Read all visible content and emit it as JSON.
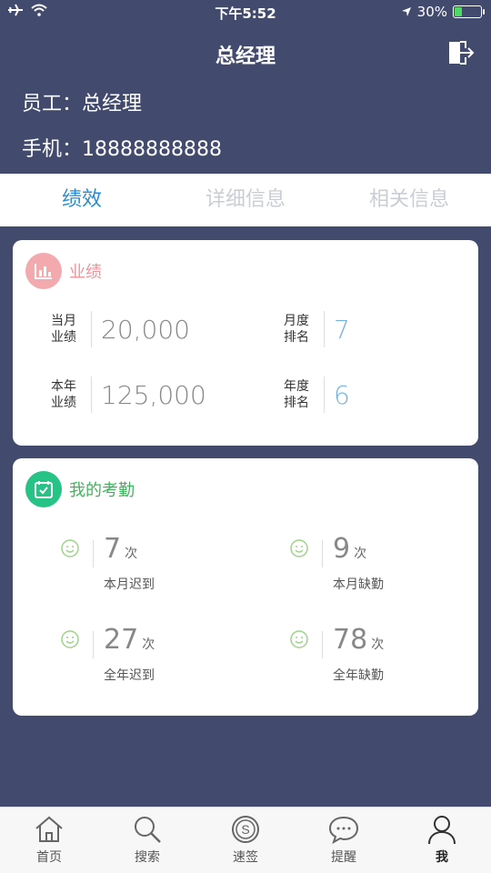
{
  "status_bar": {
    "time": "下午5:52",
    "battery_percent": "30%",
    "battery_level": 0.3
  },
  "header": {
    "title": "总经理"
  },
  "user": {
    "employee_label": "员工：",
    "employee_name": "总经理",
    "phone_label": "手机：",
    "phone": "18888888888"
  },
  "tabs": [
    {
      "label": "绩效",
      "active": true
    },
    {
      "label": "详细信息",
      "active": false
    },
    {
      "label": "相关信息",
      "active": false
    }
  ],
  "performance": {
    "title": "业绩",
    "metrics": [
      {
        "label_line1": "当月",
        "label_line2": "业绩",
        "value": "20,000"
      },
      {
        "label_line1": "月度",
        "label_line2": "排名",
        "value": "7"
      },
      {
        "label_line1": "本年",
        "label_line2": "业绩",
        "value": "125,000"
      },
      {
        "label_line1": "年度",
        "label_line2": "排名",
        "value": "6"
      }
    ]
  },
  "attendance": {
    "title": "我的考勤",
    "items": [
      {
        "value": "7",
        "unit": "次",
        "label": "本月迟到"
      },
      {
        "value": "9",
        "unit": "次",
        "label": "本月缺勤"
      },
      {
        "value": "27",
        "unit": "次",
        "label": "全年迟到"
      },
      {
        "value": "78",
        "unit": "次",
        "label": "全年缺勤"
      }
    ]
  },
  "bottom_nav": [
    {
      "label": "首页",
      "icon": "home-icon"
    },
    {
      "label": "搜索",
      "icon": "search-icon"
    },
    {
      "label": "速签",
      "icon": "quick-sign-icon"
    },
    {
      "label": "提醒",
      "icon": "chat-bubble-icon"
    },
    {
      "label": "我",
      "icon": "user-icon",
      "active": true
    }
  ],
  "colors": {
    "header_bg": "#424b6e",
    "active_tab": "#2a8bd0",
    "performance_accent": "#f3aaaf",
    "attendance_accent": "#27c386"
  }
}
